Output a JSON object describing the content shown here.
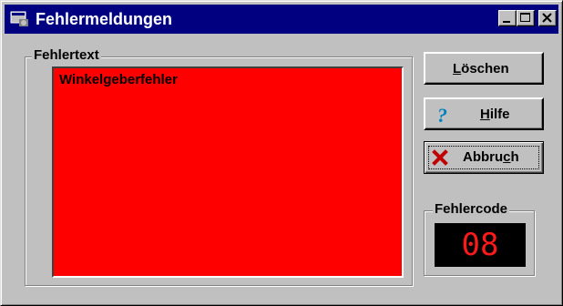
{
  "window": {
    "title": "Fehlermeldungen"
  },
  "titlebar": {
    "minimize_icon": "minimize-icon",
    "maximize_icon": "maximize-icon",
    "close_icon": "close-icon"
  },
  "fehlertext": {
    "label": "Fehlertext",
    "items": [
      "Winkelgeberfehler"
    ],
    "background_color": "#ff0000"
  },
  "buttons": {
    "loeschen": {
      "label_u": "L",
      "label_rest": "öschen"
    },
    "hilfe": {
      "label_u": "H",
      "label_rest": "ilfe",
      "icon": "question-mark-icon"
    },
    "abbruch": {
      "label_pre": "Abbru",
      "label_u": "c",
      "label_post": "h",
      "icon": "x-cancel-icon"
    }
  },
  "fehlercode": {
    "label": "Fehlercode",
    "value": "08",
    "color": "#ff1a1a"
  }
}
